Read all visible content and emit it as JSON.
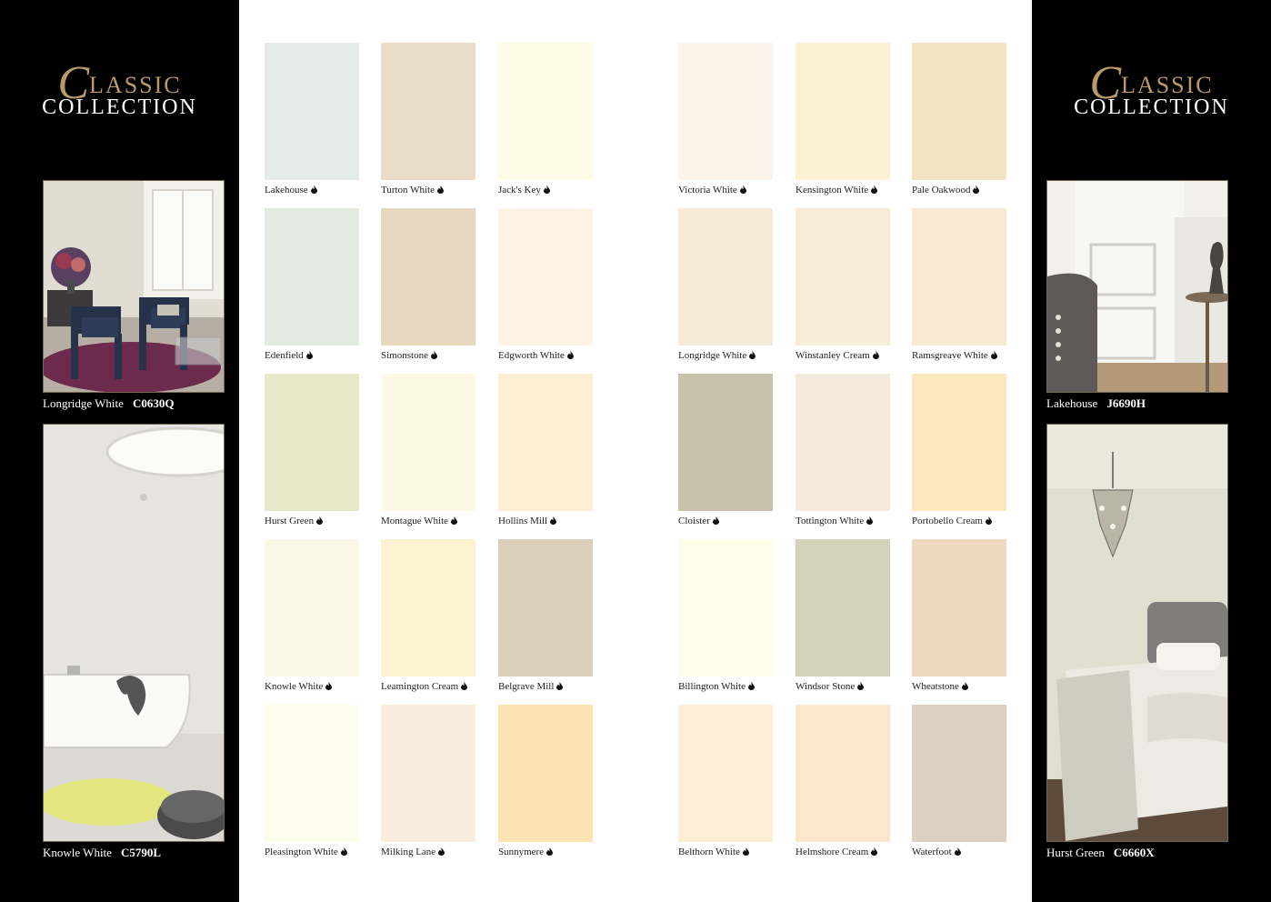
{
  "collection": {
    "title_initial": "C",
    "title_rest": "LASSIC",
    "title_line2": "COLLECTION"
  },
  "photos": [
    {
      "name": "Longridge White",
      "code": "C0630Q"
    },
    {
      "name": "Knowle White",
      "code": "C5790L"
    },
    {
      "name": "Lakehouse",
      "code": "J6690H"
    },
    {
      "name": "Hurst Green",
      "code": "C6660X"
    }
  ],
  "swatches": [
    {
      "name": "Lakehouse",
      "color": "#e4ece9"
    },
    {
      "name": "Turton White",
      "color": "#e9dcc8"
    },
    {
      "name": "Jack's Key",
      "color": "#fefbe6"
    },
    {
      "name": "Victoria White",
      "color": "#fcf4eb"
    },
    {
      "name": "Kensington White",
      "color": "#fdf1d4"
    },
    {
      "name": "Pale Oakwood",
      "color": "#f2e4c2"
    },
    {
      "name": "Edenfield",
      "color": "#e3eadf"
    },
    {
      "name": "Simonstone",
      "color": "#e7d8bf"
    },
    {
      "name": "Edgworth White",
      "color": "#fef3e3"
    },
    {
      "name": "Longridge White",
      "color": "#f4ead7"
    },
    {
      "name": "Winstanley Cream",
      "color": "#f7ecd6"
    },
    {
      "name": "Ramsgreave White",
      "color": "#f7e8d2"
    },
    {
      "name": "Hurst Green",
      "color": "#e7e8c8"
    },
    {
      "name": "Montague White",
      "color": "#fef9e5"
    },
    {
      "name": "Hollins Mill",
      "color": "#fdefd4"
    },
    {
      "name": "Cloister",
      "color": "#c9c2aa"
    },
    {
      "name": "Tottington White",
      "color": "#f3eadb"
    },
    {
      "name": "Portobello Cream",
      "color": "#fde7bd"
    },
    {
      "name": "Knowle White",
      "color": "#fcf8e8"
    },
    {
      "name": "Leamington Cream",
      "color": "#fdf3d1"
    },
    {
      "name": "Belgrave Mill",
      "color": "#dacfb9"
    },
    {
      "name": "Billington White",
      "color": "#fefde9"
    },
    {
      "name": "Windsor Stone",
      "color": "#d6d2b9"
    },
    {
      "name": "Wheatstone",
      "color": "#efd9c0"
    },
    {
      "name": "Pleasington White",
      "color": "#fdfdee"
    },
    {
      "name": "Milking Lane",
      "color": "#f9eedd"
    },
    {
      "name": "Sunnymere",
      "color": "#fde2b4"
    },
    {
      "name": "Belthorn White",
      "color": "#fdefd5"
    },
    {
      "name": "Helmshore Cream",
      "color": "#fbe7cb"
    },
    {
      "name": "Waterfoot",
      "color": "#dcd1c1"
    }
  ]
}
